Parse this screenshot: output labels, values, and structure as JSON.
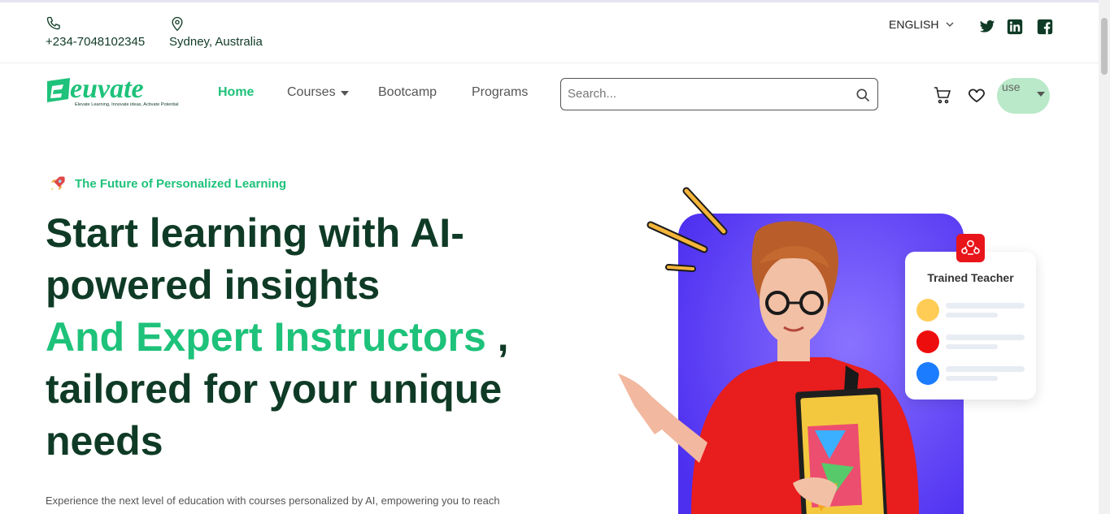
{
  "topbar": {
    "phone": "+234-7048102345",
    "location": "Sydney, Australia",
    "language": "ENGLISH",
    "social": [
      "twitter-icon",
      "linkedin-icon",
      "facebook-icon"
    ]
  },
  "nav": {
    "logo_text": "euvate",
    "logo_tagline": "Elevate Learning, Innovate ideas, Activate Potential",
    "links": [
      {
        "label": "Home",
        "active": true
      },
      {
        "label": "Courses",
        "has_dropdown": true
      },
      {
        "label": "Bootcamp"
      },
      {
        "label": "Programs"
      }
    ],
    "search_placeholder": "Search...",
    "avatar_alt": "use"
  },
  "hero": {
    "tagline": "The Future of Personalized Learning",
    "title_line1": "Start learning with AI-powered insights",
    "title_accent": "And Expert Instructors",
    "title_comma": " ,",
    "title_line2": "tailored for your unique needs",
    "description": "Experience the next level of education with courses personalized by AI, empowering you to reach"
  },
  "card": {
    "title": "Trained Teacher",
    "dot_colors": [
      "#ffcd56",
      "#ee0d0d",
      "#1c7cff"
    ]
  },
  "colors": {
    "brand_green": "#1ec27a",
    "dark_green": "#0f3b26",
    "purple": "#5b38f0"
  }
}
